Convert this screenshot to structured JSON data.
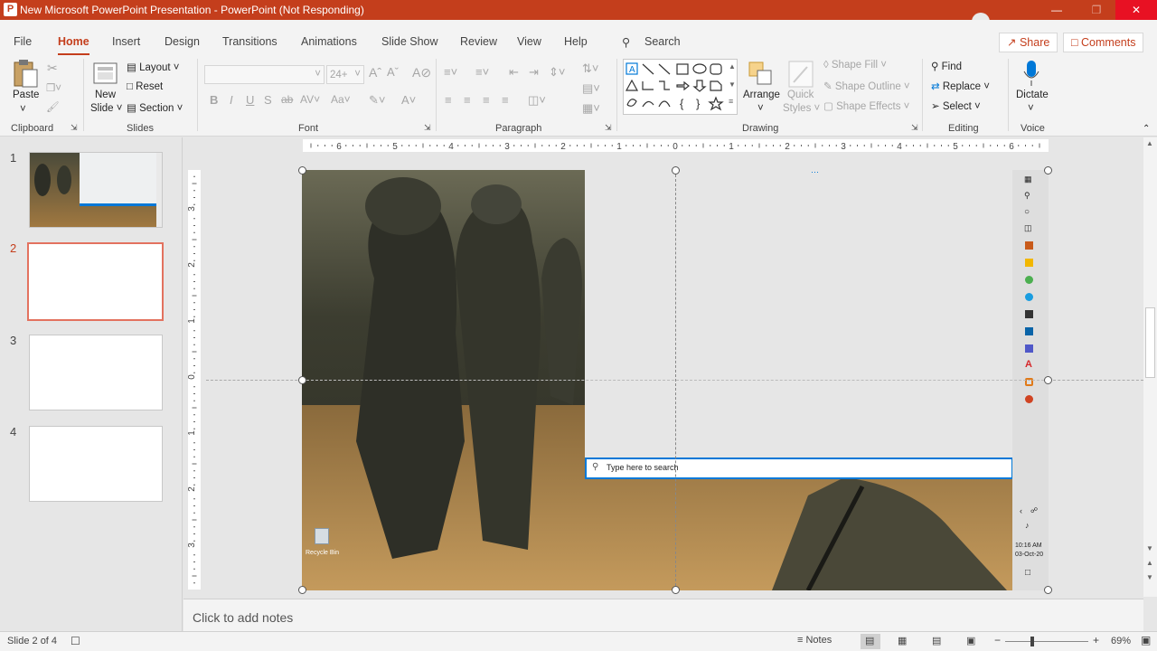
{
  "window": {
    "title": "New Microsoft PowerPoint Presentation - PowerPoint (Not Responding)",
    "app_icon": "P"
  },
  "tabs": [
    {
      "label": "File"
    },
    {
      "label": "Home"
    },
    {
      "label": "Insert"
    },
    {
      "label": "Design"
    },
    {
      "label": "Transitions"
    },
    {
      "label": "Animations"
    },
    {
      "label": "Slide Show"
    },
    {
      "label": "Review"
    },
    {
      "label": "View"
    },
    {
      "label": "Help"
    }
  ],
  "search": {
    "label": "Search"
  },
  "share": {
    "label": "Share"
  },
  "comments": {
    "label": "Comments"
  },
  "ribbon": {
    "clipboard": {
      "paste": "Paste",
      "group": "Clipboard"
    },
    "slides": {
      "new_slide_1": "New",
      "new_slide_2": "Slide",
      "layout": "Layout",
      "reset": "Reset",
      "section": "Section",
      "group": "Slides"
    },
    "font": {
      "size": "24+",
      "group": "Font"
    },
    "paragraph": {
      "group": "Paragraph"
    },
    "drawing": {
      "arrange": "Arrange",
      "quick_styles_1": "Quick",
      "quick_styles_2": "Styles",
      "shape_fill": "Shape Fill",
      "shape_outline": "Shape Outline",
      "shape_effects": "Shape Effects",
      "group": "Drawing"
    },
    "editing": {
      "find": "Find",
      "replace": "Replace",
      "select": "Select",
      "group": "Editing"
    },
    "voice": {
      "dictate": "Dictate",
      "group": "Voice"
    }
  },
  "slides": [
    {
      "number": "1"
    },
    {
      "number": "2"
    },
    {
      "number": "3"
    },
    {
      "number": "4"
    }
  ],
  "ruler": {
    "h_labels": [
      "6",
      "5",
      "4",
      "3",
      "2",
      "1",
      "0",
      "1",
      "2",
      "3",
      "4",
      "5",
      "6"
    ],
    "v_labels": [
      "3",
      "2",
      "1",
      "0",
      "1",
      "2",
      "3"
    ]
  },
  "slide_content": {
    "search_placeholder": "Type here to search",
    "recycle_bin": "Recycle Bin",
    "clock_time": "10:16 AM",
    "clock_date": "03-Oct-20"
  },
  "notes": {
    "placeholder": "Click to add notes"
  },
  "status": {
    "slide_info": "Slide 2 of 4",
    "notes_label": "Notes",
    "zoom": "69%"
  },
  "colors": {
    "accent": "#c43e1c",
    "selected_thumb": "#e3725f",
    "taskbar_blue": "#0078d7"
  }
}
